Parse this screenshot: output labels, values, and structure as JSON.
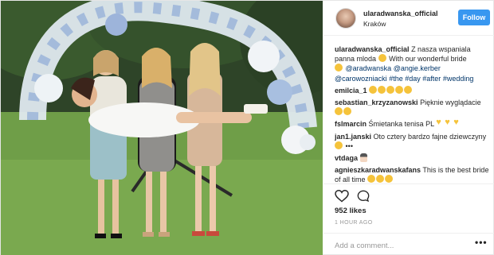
{
  "post": {
    "username": "ularadwanska_official",
    "location": "Kraków",
    "follow_label": "Follow",
    "caption": {
      "user": "ularadwanska_official",
      "text_1": "Z nasza wspaniala panna mloda",
      "text_2": "With our wonderful bride",
      "mentions": [
        "@aradwanska",
        "@angie.kerber",
        "@carowozniacki"
      ],
      "hashtags": [
        "#the",
        "#day",
        "#after",
        "#wedding"
      ]
    },
    "comments": [
      {
        "user": "emilcia_1",
        "text": ""
      },
      {
        "user": "sebastian_krzyzanowski",
        "text": "Pięknie wyglądacie"
      },
      {
        "user": "fslmarcin",
        "text": "Śmietanka tenisa PL"
      },
      {
        "user": "jan1.janski",
        "text": "Oto cztery bardzo fajne dziewczyny"
      },
      {
        "user": "vtdaga",
        "text": ""
      },
      {
        "user": "agnieszkaradwanskafans",
        "text": "This is the best bride of all time"
      }
    ],
    "likes": "952 likes",
    "time": "1 HOUR AGO",
    "add_comment_placeholder": "Add a comment...",
    "more_label": "•••"
  },
  "icons": {
    "like": "heart-outline-icon",
    "comment": "speech-bubble-icon",
    "more": "more-dots-icon"
  },
  "colors": {
    "follow_button": "#3897f0",
    "mention": "#003569",
    "muted": "#999999"
  }
}
